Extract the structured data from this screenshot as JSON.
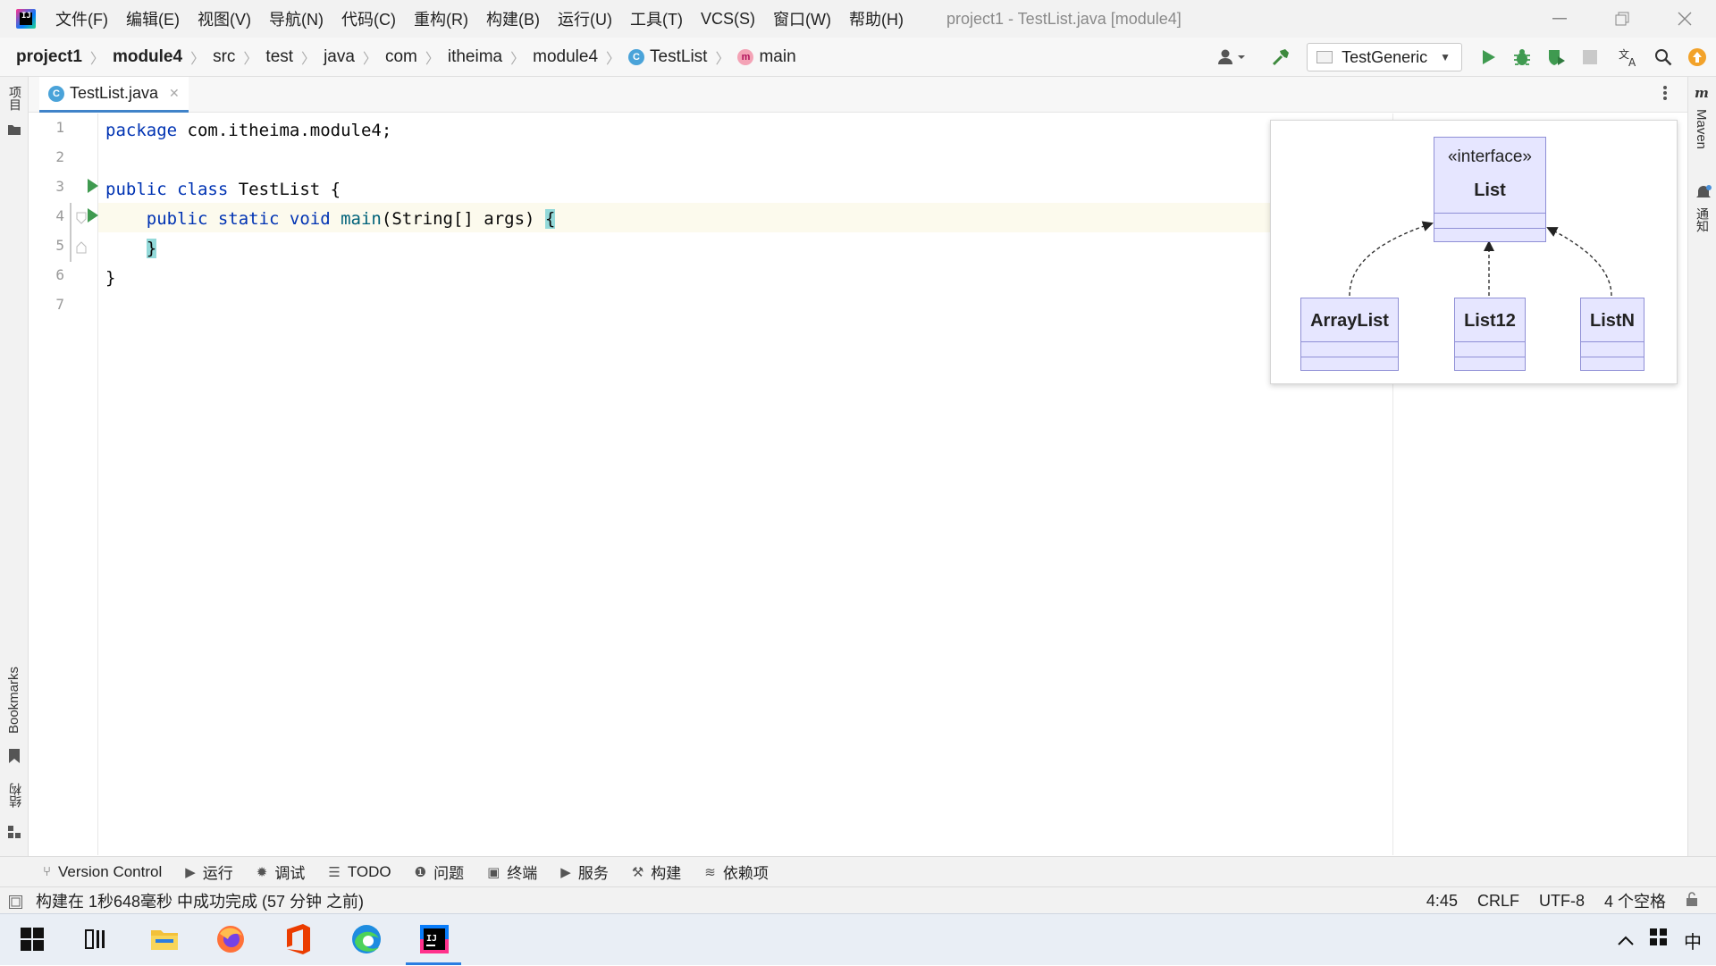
{
  "window": {
    "menu": [
      "文件(F)",
      "编辑(E)",
      "视图(V)",
      "导航(N)",
      "代码(C)",
      "重构(R)",
      "构建(B)",
      "运行(U)",
      "工具(T)",
      "VCS(S)",
      "窗口(W)",
      "帮助(H)"
    ],
    "title": "project1 - TestList.java [module4]"
  },
  "breadcrumb": {
    "items": [
      "project1",
      "module4",
      "src",
      "test",
      "java",
      "com",
      "itheima",
      "module4",
      "TestList",
      "main"
    ]
  },
  "toolbar": {
    "run_config": "TestGeneric"
  },
  "left_strip": {
    "project_label": "项目",
    "bookmarks_label": "Bookmarks",
    "structure_label": "结构"
  },
  "right_strip": {
    "maven_label": "Maven",
    "notifications_label": "通知"
  },
  "editor": {
    "tab_label": "TestList.java",
    "line_numbers": [
      "1",
      "2",
      "3",
      "4",
      "5",
      "6",
      "7"
    ],
    "lines": {
      "l1_kw": "package",
      "l1_rest": " com.itheima.module4;",
      "l3_kw": "public class",
      "l3_rest": " TestList {",
      "l4_kw": "    public static void",
      "l4_fn": " main",
      "l4_rest": "(String[] args) ",
      "l4_brace": "{",
      "l5_indent": "    ",
      "l5_brace": "}",
      "l6": "}"
    }
  },
  "uml": {
    "interface_stereotype": "«interface»",
    "interface_name": "List",
    "implementations": [
      "ArrayList",
      "List12",
      "ListN"
    ]
  },
  "bottom_tools": {
    "items": [
      "Version Control",
      "运行",
      "调试",
      "TODO",
      "问题",
      "终端",
      "服务",
      "构建",
      "依赖项"
    ]
  },
  "status": {
    "message": "构建在 1秒648毫秒 中成功完成 (57 分钟 之前)",
    "position": "4:45",
    "line_sep": "CRLF",
    "encoding": "UTF-8",
    "indent": "4 个空格"
  },
  "taskbar": {
    "ime": "中"
  }
}
